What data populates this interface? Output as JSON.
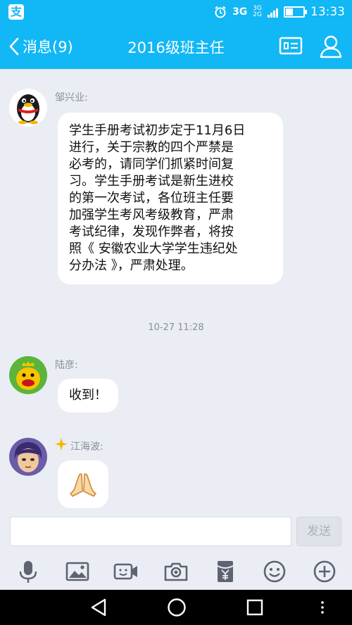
{
  "status_bar": {
    "network_3g": "3G",
    "network_3g_small": "3G",
    "network_2g_small": "2G",
    "time": "13:33"
  },
  "header": {
    "back_label": "消息(9)",
    "title": "2016级班主任"
  },
  "messages": [
    {
      "sender": "邹兴业:",
      "lines": [
        "学生手册考试初步定于11月6日",
        "进行，关于宗教的四个严禁是",
        "必考的，请同学们抓紧时间复",
        "习。学生手册考试是新生进校",
        "的第一次考试，各位班主任要",
        "加强学生考风考级教育，严肃",
        "考试纪律，发现作弊者，将按",
        "照《 安徽农业大学学生违纪处",
        "分办法 》，严肃处理。"
      ]
    },
    {
      "timestamp": "10-27 11:28"
    },
    {
      "sender": "陆彦:",
      "text": "收到！"
    },
    {
      "sender": "江海波:",
      "emoji_icon": "praying-hands-icon"
    }
  ],
  "composer": {
    "input_value": "",
    "send_label": "发送",
    "tools": [
      "microphone-icon",
      "image-icon",
      "video-call-icon",
      "camera-icon",
      "red-packet-icon",
      "emoji-icon",
      "plus-icon"
    ]
  },
  "colors": {
    "accent": "#12b7f5",
    "background": "#eaedf3",
    "bubble": "#ffffff"
  }
}
